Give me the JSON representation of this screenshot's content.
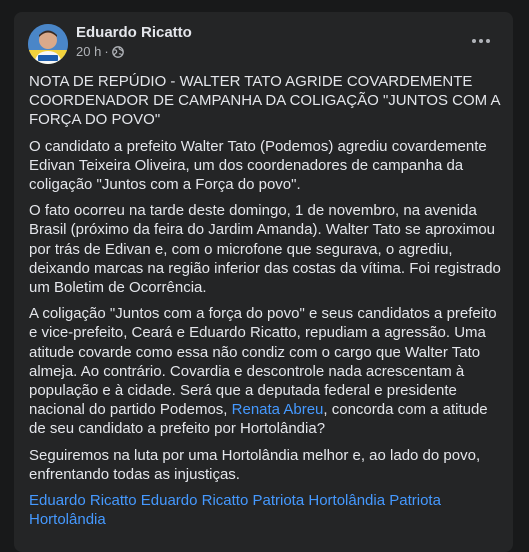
{
  "post": {
    "author": "Eduardo Ricatto",
    "time": "20 h",
    "separator": "·",
    "privacy_icon": "globe-icon",
    "more_icon": "more-horizontal-icon",
    "title": "NOTA DE REPÚDIO - WALTER TATO AGRIDE COVARDEMENTE COORDENADOR DE CAMPANHA DA COLIGAÇÃO \"JUNTOS COM A FORÇA DO POVO\"",
    "paragraph1": "O candidato a prefeito Walter Tato (Podemos) agrediu covardemente Edivan Teixeira Oliveira, um dos coordenadores de campanha da coligação \"Juntos com a Força do povo\".",
    "paragraph2": "O fato ocorreu na tarde deste domingo, 1 de novembro, na avenida Brasil (próximo da feira do Jardim Amanda). Walter Tato se aproximou por trás de Edivan e, com o microfone que segurava, o agrediu, deixando marcas na região inferior das costas da vítima. Foi registrado um Boletim de Ocorrência.",
    "paragraph3_before": "A coligação \"Juntos com a força do povo\" e seus candidatos a prefeito e vice-prefeito, Ceará e Eduardo Ricatto, repudiam a agressão. Uma atitude covarde como essa não condiz com o cargo que Walter Tato almeja. Ao contrário. Covardia e descontrole nada acrescentam à população e à cidade. Será que a deputada federal e presidente nacional do partido Podemos, ",
    "paragraph3_link": "Renata Abreu",
    "paragraph3_after": ", concorda com a atitude de seu candidato a prefeito por Hortolândia?",
    "paragraph4": "Seguiremos na luta por uma Hortolândia melhor e, ao lado do povo, enfrentando todas as injustiças.",
    "tags": [
      "Eduardo Ricatto",
      "Eduardo Ricatto Patriota",
      "Hortolândia",
      "Patriota Hortolândia"
    ]
  },
  "colors": {
    "background": "#18191a",
    "card": "#242526",
    "primary_text": "#e4e6eb",
    "secondary_text": "#b0b3b8",
    "link": "#4599ff"
  }
}
